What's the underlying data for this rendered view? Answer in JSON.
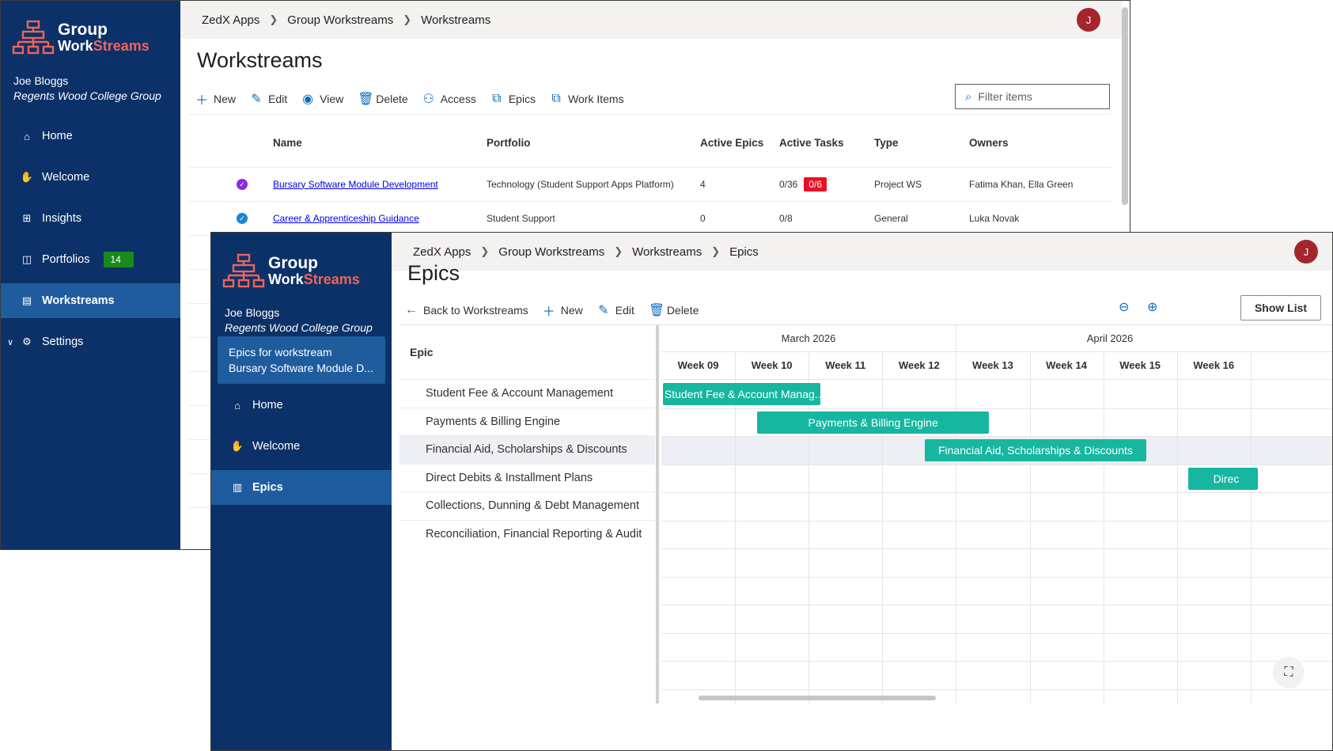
{
  "app": {
    "logo_line1": "Group",
    "logo_line2a": "Work",
    "logo_line2b": "Streams",
    "user_name": "Joe Bloggs",
    "user_org": "Regents Wood College Group",
    "avatar_initial": "J"
  },
  "win1": {
    "breadcrumb": [
      "ZedX Apps",
      "Group Workstreams",
      "Workstreams"
    ],
    "nav": [
      {
        "label": "Home",
        "icon": "home-icon"
      },
      {
        "label": "Welcome",
        "icon": "hand-icon"
      },
      {
        "label": "Insights",
        "icon": "grid-icon"
      },
      {
        "label": "Portfolios",
        "icon": "portfolio-icon",
        "badge": "14"
      },
      {
        "label": "Workstreams",
        "icon": "workstreams-icon",
        "active": true
      },
      {
        "label": "Settings",
        "icon": "gear-icon"
      }
    ],
    "title": "Workstreams",
    "commands": [
      "New",
      "Edit",
      "View",
      "Delete",
      "Access",
      "Epics",
      "Work Items"
    ],
    "filter_placeholder": "Filter items",
    "columns": [
      "Name",
      "Portfolio",
      "Active Epics",
      "Active Tasks",
      "Type",
      "Owners"
    ],
    "rows": [
      {
        "name": "Bursary Software Module Development",
        "portfolio": "Technology (Student Support Apps Platform)",
        "active_epics": "4",
        "active_tasks": "0/36",
        "overdue": "0/6",
        "type": "Project WS",
        "owners": "Fatima Khan, Ella Green",
        "status_color": "#8a2be2"
      },
      {
        "name": "Career & Apprenticeship Guidance",
        "portfolio": "Student Support",
        "active_epics": "0",
        "active_tasks": "0/8",
        "overdue": "",
        "type": "General",
        "owners": "Luka Novak",
        "status_color": "#1a86d9"
      }
    ]
  },
  "win2": {
    "breadcrumb": [
      "ZedX Apps",
      "Group Workstreams",
      "Workstreams",
      "Epics"
    ],
    "card_line1": "Epics for workstream",
    "card_line2": "Bursary Software Module D...",
    "nav": [
      {
        "label": "Home",
        "icon": "home-icon"
      },
      {
        "label": "Welcome",
        "icon": "hand-icon"
      },
      {
        "label": "Epics",
        "icon": "books-icon",
        "active": true
      }
    ],
    "title": "Epics",
    "commands": [
      "Back to Workstreams",
      "New",
      "Edit",
      "Delete"
    ],
    "show_list": "Show List",
    "epic_header": "Epic",
    "months": [
      "March 2026",
      "April 2026"
    ],
    "weeks": [
      "Week 09",
      "Week 10",
      "Week 11",
      "Week 12",
      "Week 13",
      "Week 14",
      "Week 15",
      "Week 16"
    ],
    "epics": [
      "Student Fee & Account Management",
      "Payments & Billing Engine",
      "Financial Aid, Scholarships & Discounts",
      "Direct Debits & Installment Plans",
      "Collections, Dunning & Debt Management",
      "Reconciliation, Financial Reporting & Audit"
    ],
    "bars": [
      {
        "label": "Student Fee & Account Manag...",
        "row": 0,
        "start_week": 0.02,
        "span_weeks": 2.14
      },
      {
        "label": "Payments & Billing Engine",
        "row": 1,
        "start_week": 1.3,
        "span_weeks": 3.15
      },
      {
        "label": "Financial Aid, Scholarships & Discounts",
        "row": 2,
        "start_week": 3.58,
        "span_weeks": 3.0
      },
      {
        "label": "Direc",
        "row": 3,
        "start_week": 7.15,
        "span_weeks": 0.95
      }
    ],
    "accent": "#17b6a0"
  }
}
